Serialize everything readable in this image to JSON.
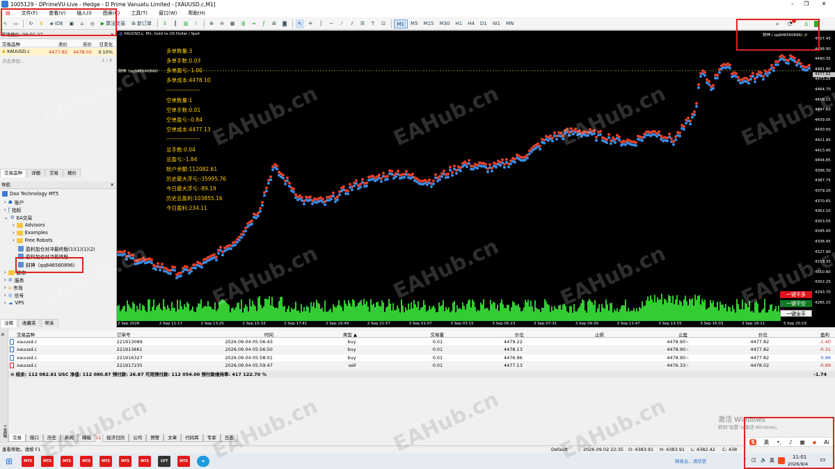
{
  "window": {
    "title": "1005129 - DPrimeVU-Live - Hedge - D Prime Vanuatu Limited - [XAUUSD.c,M1]",
    "minimize": "–",
    "maximize": "❐",
    "close": "✕"
  },
  "menu": [
    "文件(F)",
    "查看(V)",
    "插入(I)",
    "图表(C)",
    "工具(T)",
    "窗口(W)",
    "帮助(H)"
  ],
  "toolbar": {
    "ide": "IDE",
    "algo": "算法交易",
    "new_order": "新订单",
    "timeframes": [
      "M1",
      "M5",
      "M15",
      "M30",
      "H1",
      "H4",
      "D1",
      "W1",
      "MN"
    ],
    "active_tf": "M1"
  },
  "market_watch": {
    "title": "市场报价: 06:01:27",
    "headers": [
      "交易品种",
      "卖价",
      "买价",
      "日变化"
    ],
    "rows": [
      {
        "symbol": "XAUUSD.c",
        "bid": "4477.82",
        "ask": "4478.02",
        "change": "0.10%"
      }
    ],
    "add": "点击添加...",
    "count": "1 / 4",
    "tabs": [
      "交易品种",
      "详细",
      "交易",
      "报价"
    ]
  },
  "navigator": {
    "title": "导航",
    "items": [
      {
        "label": "Doo Technology MT5"
      },
      {
        "label": "账户"
      },
      {
        "label": "指标"
      },
      {
        "label": "EA交易"
      },
      {
        "label": "Advisors"
      },
      {
        "label": "Examples"
      },
      {
        "label": "Free Robots"
      },
      {
        "label": "盈利加仓对冲最终版(1)(1)(1)(2)"
      },
      {
        "label": "盈利加仓对冲最终版"
      },
      {
        "label": "财神（qq846560896）"
      },
      {
        "label": "脚本"
      },
      {
        "label": "服务"
      },
      {
        "label": "市场"
      },
      {
        "label": "信号"
      },
      {
        "label": "VPS"
      }
    ],
    "tabs": [
      "注释",
      "收藏夹",
      "帮关"
    ]
  },
  "chart": {
    "header": "XAUUSD.c, M1:  Gold vs US Dollar / Spot",
    "ea_label": "财神（qq846560896）",
    "ea_tag": "财神 ( qq846560896)",
    "info": [
      "多单数量:3",
      "多单手数:0.03",
      "多单盈亏:-1.00",
      "多单成本:4478.10",
      "------------------",
      "空单数量:1",
      "空单手数:0.01",
      "空单盈亏:-0.84",
      "空单成本:4477.13",
      "------------------",
      "总手数:0.04",
      "总盈亏:-1.84",
      "账户余额:112082.61",
      "历史最大浮亏:-35995.76",
      "今日最大浮亏:-89.19",
      "历史总盈利:103855.16",
      "今日盈利:234.11"
    ],
    "prices": [
      "4507.45",
      "4498.90",
      "4490.35",
      "4481.80",
      "4473.25",
      "4464.70",
      "4456.15",
      "4447.60",
      "4439.05",
      "4430.50",
      "4421.95",
      "4413.40",
      "4404.85",
      "4396.30",
      "4387.75",
      "4379.20",
      "4370.65",
      "4362.10",
      "4353.55",
      "4345.00",
      "4336.45",
      "4327.90",
      "4319.35",
      "4310.80",
      "4302.25",
      "4293.70",
      "4285.15"
    ],
    "bid_tag": "4477.82",
    "times": [
      "2 Sep 2026",
      "2 Sep 11:17",
      "2 Sep 13:25",
      "2 Sep 15:33",
      "2 Sep 17:41",
      "2 Sep 19:49",
      "2 Sep 21:57",
      "3 Sep 01:07",
      "3 Sep 03:15",
      "3 Sep 05:23",
      "3 Sep 07:31",
      "3 Sep 09:39",
      "3 Sep 11:47",
      "3 Sep 13:55",
      "3 Sep 16:03",
      "3 Sep 18:11",
      "3 Sep 20:19"
    ],
    "buttons": [
      "一键平多",
      "一键平空",
      "一键全平"
    ],
    "colors": {
      "buy": "#e8402a",
      "sell": "#3a8ee8",
      "volume": "#33cc33"
    }
  },
  "terminal": {
    "headers": [
      "交易品种",
      "订单号",
      "时间",
      "类型 ▲",
      "交易量",
      "价位",
      "止损",
      "止盈",
      "价位",
      "盈利"
    ],
    "rows": [
      {
        "symbol": "xauusd.c",
        "order": "221913089",
        "time": "2026.09.04 05:56:43",
        "type": "buy",
        "volume": "0.01",
        "price": "4479.22",
        "sl": "",
        "tp": "4478.90",
        "current": "4477.82",
        "profit": "-1.40"
      },
      {
        "symbol": "xauusd.c",
        "order": "221913661",
        "time": "2026.09.04 05:56:50",
        "type": "buy",
        "volume": "0.01",
        "price": "4478.13",
        "sl": "",
        "tp": "4478.90",
        "current": "4477.82",
        "profit": "-0.31"
      },
      {
        "symbol": "xauusd.c",
        "order": "221916327",
        "time": "2026.09.04 05:58:01",
        "type": "buy",
        "volume": "0.01",
        "price": "4476.96",
        "sl": "",
        "tp": "4478.90",
        "current": "4477.82",
        "profit": "0.86"
      },
      {
        "symbol": "xauusd.c",
        "order": "221917235",
        "time": "2026.09.04 05:59:47",
        "type": "sell",
        "volume": "0.01",
        "price": "4477.13",
        "sl": "",
        "tp": "4476.33",
        "current": "4478.02",
        "profit": "-0.89"
      }
    ],
    "balance": "结余: 112 082.61 USC  净值: 112 080.87  预付款: 26.87  可用预付款: 112 054.00  预付款维持率: 417 122.70 %",
    "total": "-1.74",
    "tabs": [
      "交易",
      "敞口",
      "历史",
      "新闻",
      "邮箱",
      "经济日历",
      "公司",
      "预警",
      "文章",
      "代码库",
      "专家",
      "日志"
    ],
    "mail_count": "11",
    "side_label": "工具箱"
  },
  "status": {
    "help": "查看帮助，请按 F1",
    "profile": "Default",
    "datetime": "2026.09.02 22:35",
    "open": "O: 4383.91",
    "high": "H: 4383.91",
    "low": "L: 4382.42",
    "close": "C: 438"
  },
  "activation": {
    "line1": "激活 Windows",
    "line2": "转到\"设置\"以激活 Windows。"
  },
  "taskbar": {
    "music": "网易云...请欣赏",
    "ime": "英",
    "time": "11:01",
    "date": "2026/9/4",
    "ime_bar": [
      "S",
      "英",
      "•,",
      "♪",
      "▦",
      "◆",
      "Ai"
    ]
  },
  "watermark": "EAHub.cn"
}
